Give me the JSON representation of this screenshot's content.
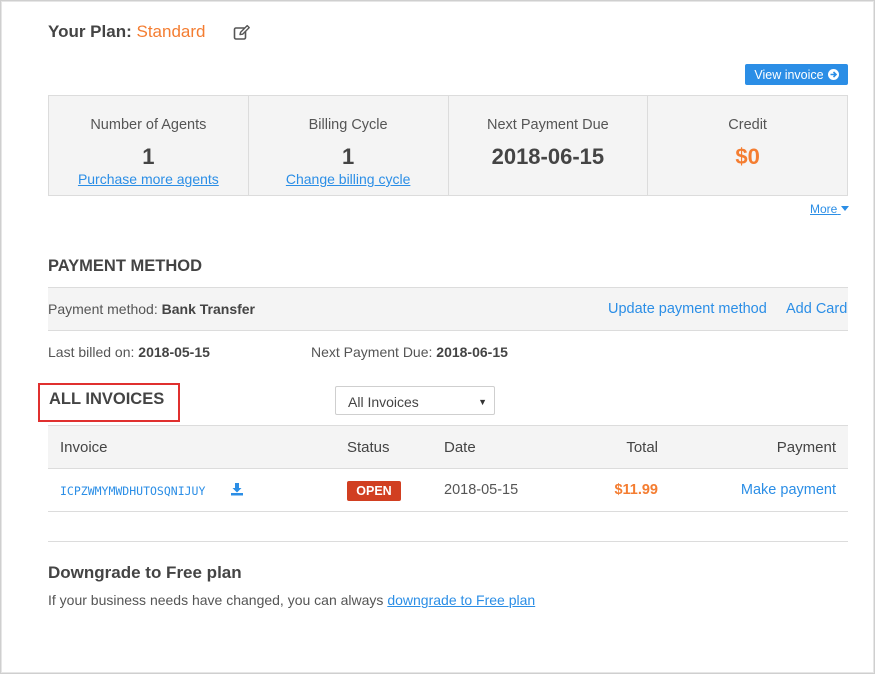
{
  "plan": {
    "label": "Your Plan:",
    "name": "Standard"
  },
  "view_invoice_label": "View invoice",
  "stats": [
    {
      "label": "Number of Agents",
      "value": "1",
      "link": "Purchase more agents"
    },
    {
      "label": "Billing Cycle",
      "value": "1",
      "link": "Change billing cycle"
    },
    {
      "label": "Next Payment Due",
      "value": "2018-06-15"
    },
    {
      "label": "Credit",
      "value": "$0"
    }
  ],
  "more_label": "More",
  "payment_method": {
    "title": "PAYMENT METHOD",
    "label": "Payment method:",
    "value": "Bank Transfer",
    "update_link": "Update payment method",
    "add_card_link": "Add Card",
    "last_billed_label": "Last billed on:",
    "last_billed_value": "2018-05-15",
    "next_due_label": "Next Payment Due:",
    "next_due_value": "2018-06-15"
  },
  "invoices": {
    "title": "ALL INVOICES",
    "filter_selected": "All Invoices",
    "columns": [
      "Invoice",
      "Status",
      "Date",
      "Total",
      "Payment"
    ],
    "rows": [
      {
        "invoice": "ICPZWMYMWDHUTOSQNIJUY",
        "status": "OPEN",
        "date": "2018-05-15",
        "total": "$11.99",
        "payment": "Make payment"
      }
    ]
  },
  "downgrade": {
    "title": "Downgrade to Free plan",
    "text": "If your business needs have changed, you can always",
    "link": "downgrade to Free plan"
  },
  "colors": {
    "accent_blue": "#2b8ee6",
    "accent_orange": "#f47d31",
    "badge_red": "#d13f21",
    "highlight_red": "#e0302f"
  }
}
